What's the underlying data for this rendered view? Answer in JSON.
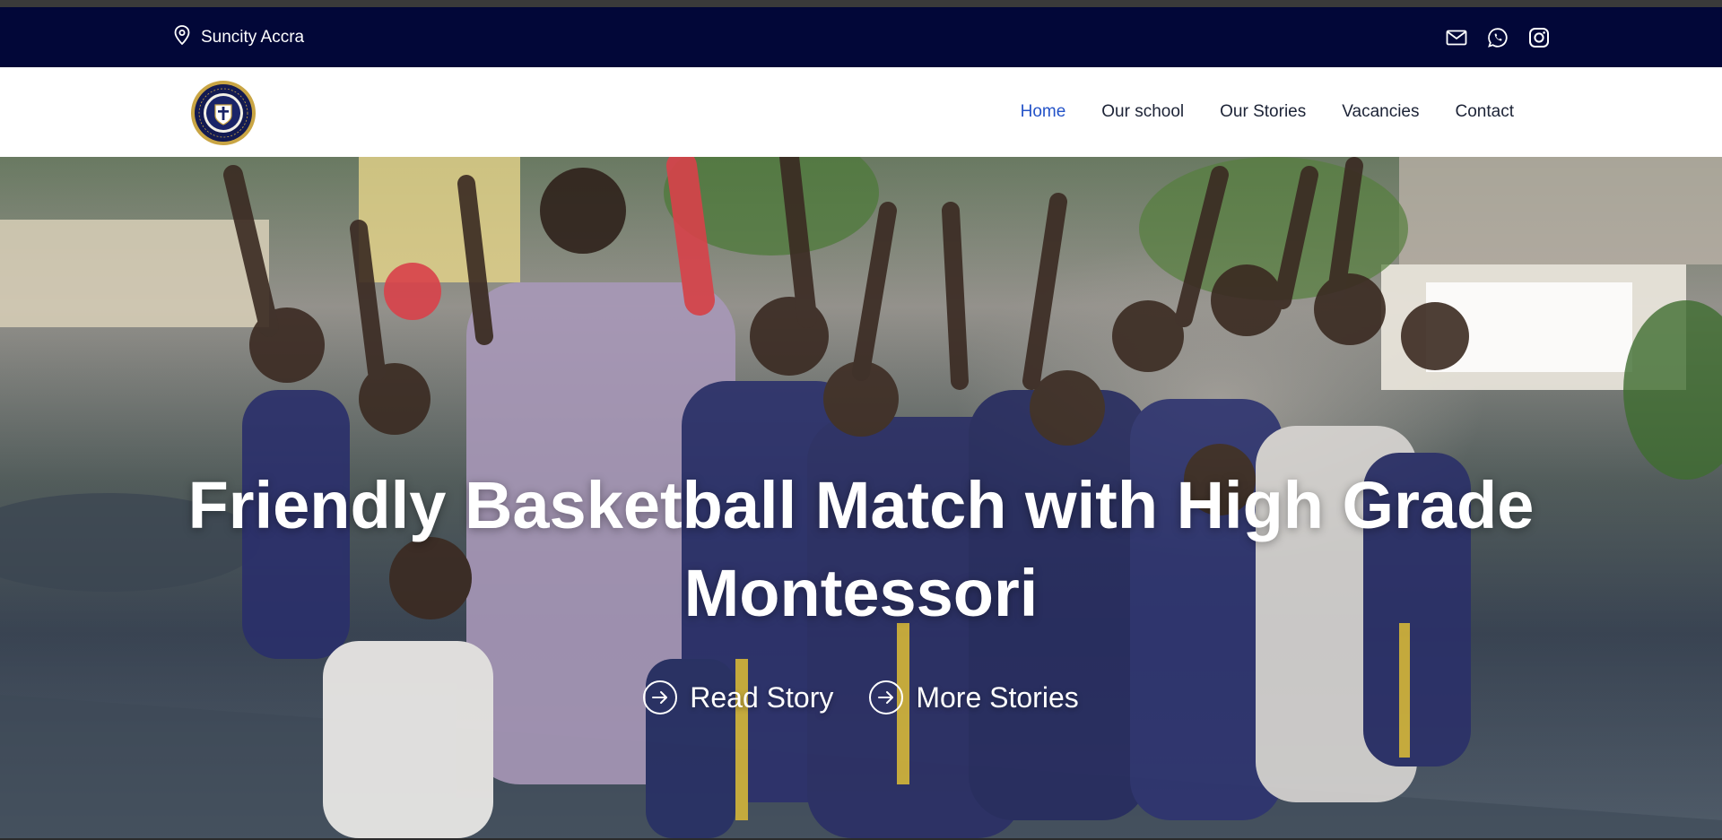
{
  "topbar": {
    "location": "Suncity Accra",
    "location_icon": "map-pin-icon",
    "social": [
      {
        "name": "mail-icon"
      },
      {
        "name": "whatsapp-icon"
      },
      {
        "name": "instagram-icon"
      }
    ],
    "background": "#020738"
  },
  "header": {
    "logo_icon": "school-crest-logo",
    "nav": [
      {
        "label": "Home",
        "active": true
      },
      {
        "label": "Our school",
        "active": false
      },
      {
        "label": "Our Stories",
        "active": false
      },
      {
        "label": "Vacancies",
        "active": false
      },
      {
        "label": "Contact",
        "active": false
      }
    ],
    "active_color": "#2453c8"
  },
  "hero": {
    "title": "Friendly Basketball Match with High Grade Montessori",
    "buttons": [
      {
        "label": "Read Story",
        "icon": "arrow-right-circle-icon"
      },
      {
        "label": "More Stories",
        "icon": "arrow-right-circle-icon"
      }
    ]
  }
}
